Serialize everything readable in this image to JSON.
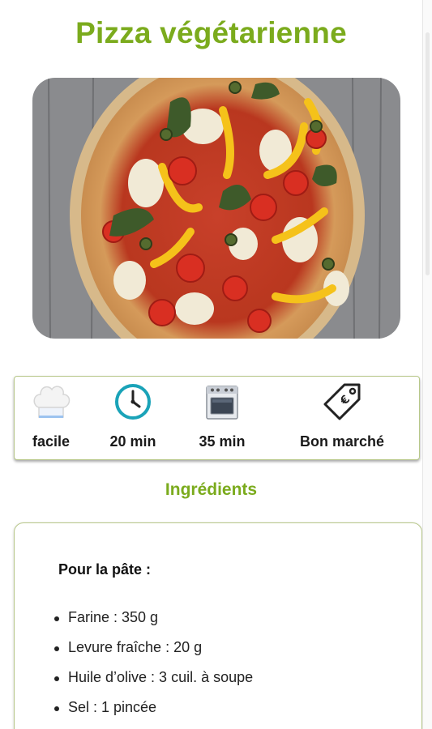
{
  "recipe": {
    "title": "Pizza végétarienne"
  },
  "hero_image": {
    "description": "photo-pizza-vegetarienne"
  },
  "info": {
    "difficulty": {
      "icon": "chef-hat-icon",
      "label": "facile"
    },
    "prep_time": {
      "icon": "clock-icon",
      "label": "20 min"
    },
    "cook_time": {
      "icon": "oven-icon",
      "label": "35 min"
    },
    "cost": {
      "icon": "price-tag-icon",
      "label": "Bon marché"
    }
  },
  "ingredients": {
    "section_title": "Ingrédients",
    "groups": [
      {
        "title": "Pour la pâte :",
        "items": [
          "Farine  : 350  g",
          "Levure fraîche  : 20  g",
          "Huile d’olive  : 3  cuil. à soupe",
          "Sel  : 1  pincée"
        ]
      }
    ]
  },
  "colors": {
    "accent_green": "#7bab1d",
    "clock_teal": "#1aa3b8",
    "border": "#b8c88a"
  }
}
